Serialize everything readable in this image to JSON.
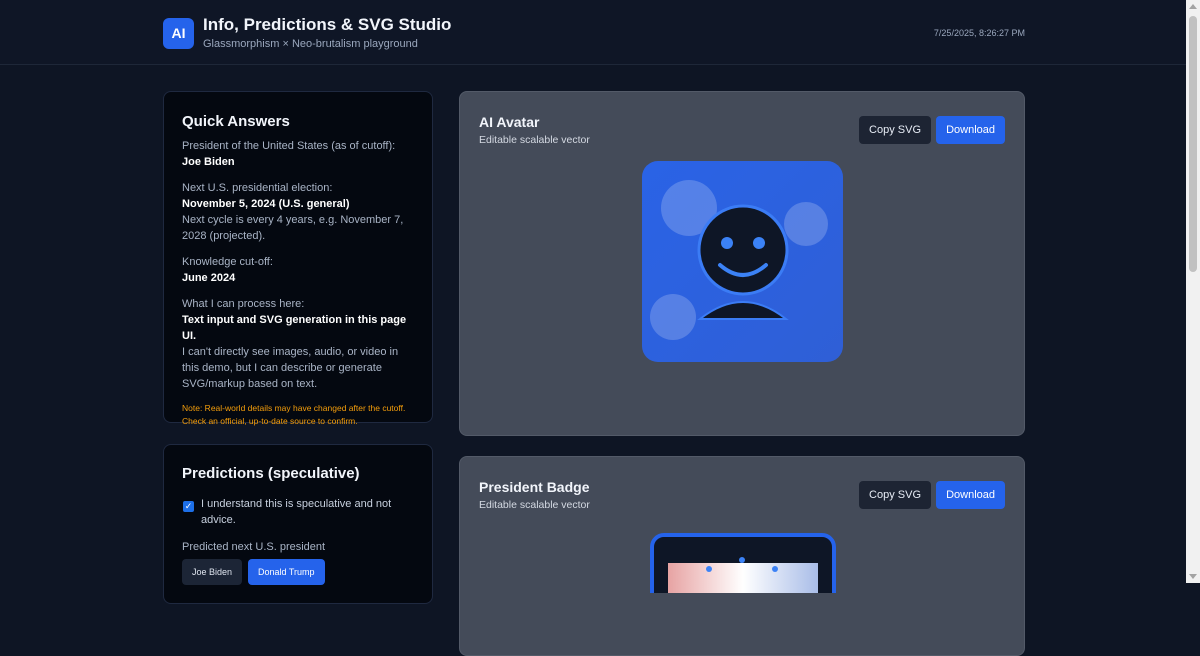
{
  "header": {
    "logo_text": "AI",
    "title": "Info, Predictions & SVG Studio",
    "subtitle": "Glassmorphism × Neo-brutalism playground",
    "timestamp": "7/25/2025, 8:26:27 PM"
  },
  "quick_answers": {
    "title": "Quick Answers",
    "items": [
      {
        "label": "President of the United States (as of cutoff):",
        "value": "Joe Biden",
        "detail": ""
      },
      {
        "label": "Next U.S. presidential election:",
        "value": "November 5, 2024 (U.S. general)",
        "detail": "Next cycle is every 4 years, e.g. November 7, 2028 (projected)."
      },
      {
        "label": "Knowledge cut-off:",
        "value": "June 2024",
        "detail": ""
      },
      {
        "label": "What I can process here:",
        "value": "Text input and SVG generation in this page UI.",
        "detail": "I can't directly see images, audio, or video in this demo, but I can describe or generate SVG/markup based on text."
      }
    ],
    "note": "Note: Real-world details may have changed after the cutoff. Check an official, up-to-date source to confirm."
  },
  "predictions": {
    "title": "Predictions (speculative)",
    "checkbox_label": "I understand this is speculative and not advice.",
    "checkbox_checked": true,
    "predict_label": "Predicted next U.S. president",
    "options": [
      "Joe Biden",
      "Donald Trump"
    ],
    "selected": "Donald Trump"
  },
  "svg_panels": [
    {
      "title": "AI Avatar",
      "subtitle": "Editable scalable vector",
      "copy_label": "Copy SVG",
      "download_label": "Download"
    },
    {
      "title": "President Badge",
      "subtitle": "Editable scalable vector",
      "copy_label": "Copy SVG",
      "download_label": "Download"
    }
  ],
  "colors": {
    "accent": "#2563eb",
    "background": "#0e1524",
    "panel": "#444b59",
    "note": "#f59e0b"
  }
}
